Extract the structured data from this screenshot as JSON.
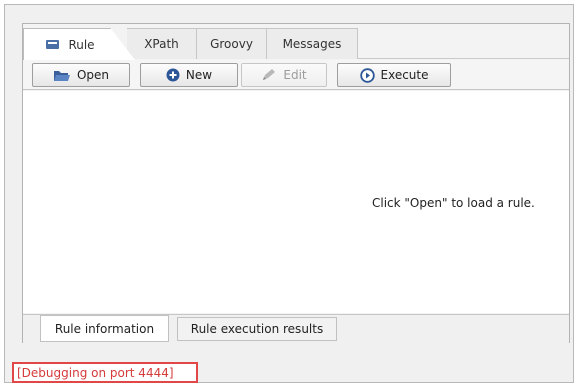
{
  "tabs": [
    {
      "label": "Rule",
      "icon": "rule-icon",
      "active": true
    },
    {
      "label": "XPath",
      "active": false
    },
    {
      "label": "Groovy",
      "active": false
    },
    {
      "label": "Messages",
      "active": false
    }
  ],
  "toolbar": {
    "open_label": "Open",
    "new_label": "New",
    "edit_label": "Edit",
    "execute_label": "Execute"
  },
  "content": {
    "hint": "Click \"Open\" to load a rule."
  },
  "bottom_tabs": [
    {
      "label": "Rule information",
      "active": true
    },
    {
      "label": "Rule execution results",
      "active": false
    }
  ],
  "status": {
    "text": "[Debugging on port 4444]",
    "color": "#d53b3b"
  },
  "colors": {
    "accent": "#2b5797",
    "highlight_border": "#e24747"
  }
}
